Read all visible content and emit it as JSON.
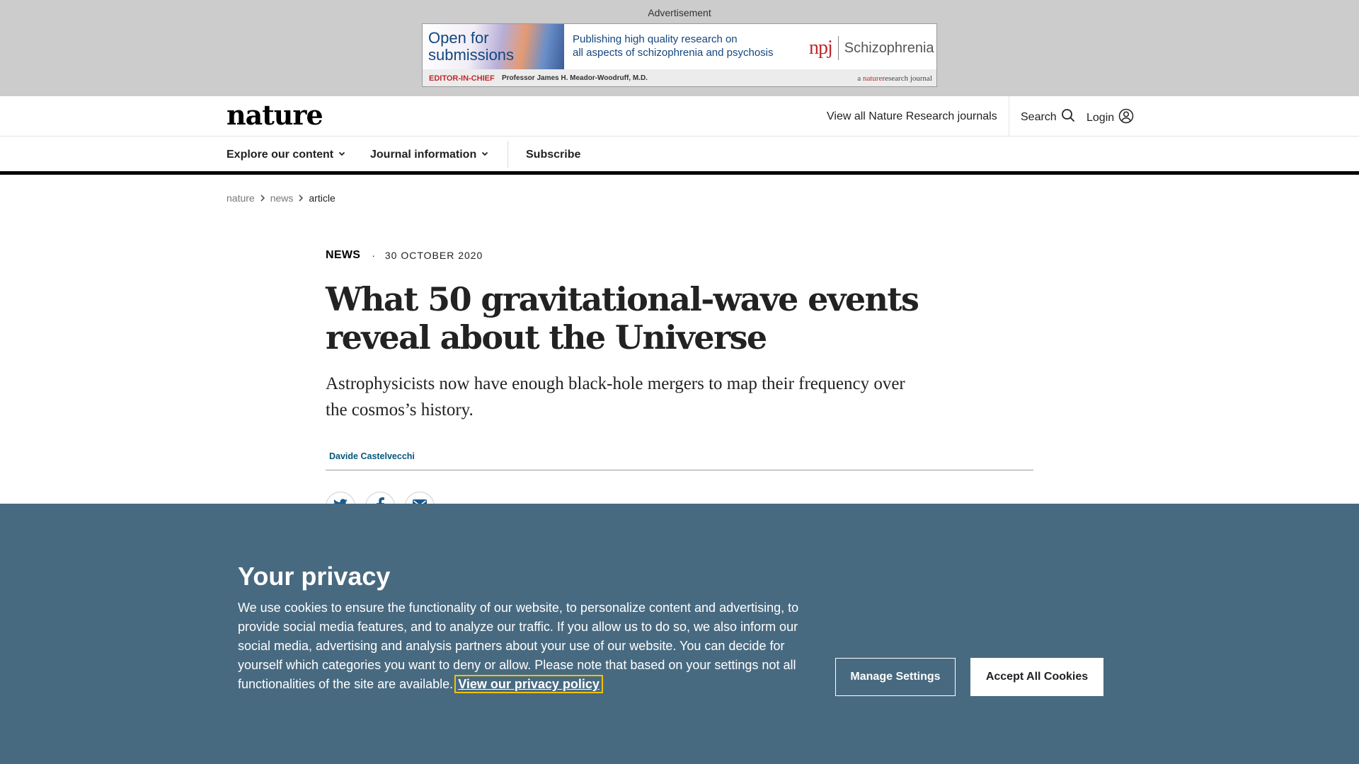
{
  "advert": {
    "label": "Advertisement",
    "headline": "Open for submissions",
    "tagline_line1": "Publishing high quality research on",
    "tagline_line2": "all aspects of schizophrenia and psychosis",
    "journal_prefix": "npj",
    "journal_name": "Schizophrenia",
    "editor_tag": "EDITOR-IN-CHIEF",
    "editor_name": "Professor James H. Meador-Woodruff, M.D.",
    "journal_note_a": "a ",
    "journal_note_brand": "nature",
    "journal_note_b": "research journal"
  },
  "header": {
    "logo": "nature",
    "journals_link": "View all Nature Research journals",
    "search_label": "Search",
    "login_label": "Login"
  },
  "nav": {
    "explore": "Explore our content",
    "journal_info": "Journal information",
    "subscribe": "Subscribe"
  },
  "breadcrumb": [
    "nature",
    "news",
    "article"
  ],
  "article": {
    "type": "NEWS",
    "separator": "·",
    "date": "30 OCTOBER 2020",
    "title": "What 50 gravitational-wave events reveal about the Universe",
    "standfirst": "Astrophysicists now have enough black-hole mergers to map their frequency over the cosmos’s history.",
    "author": "Davide Castelvecchi"
  },
  "cookie": {
    "title": "Your privacy",
    "body": "We use cookies to ensure the functionality of our website, to personalize content and advertising, to provide social media features, and to analyze our traffic. If you allow us to do so, we also inform our social media, advertising and analysis partners about your use of our website. You can decide for yourself which categories you want to deny or allow. Please note that based on your settings not all functionalities of the site are available. ",
    "privacy_link": "View our privacy policy",
    "manage_button": "Manage Settings",
    "accept_button": "Accept All Cookies"
  },
  "colors": {
    "cookie_background": "#486a80",
    "ad_background": "#cccccc",
    "author_link": "#06567b",
    "focus_outline": "#f2c200",
    "twitter_icon": "#1a5a8f",
    "facebook_icon": "#1a5a8f"
  }
}
